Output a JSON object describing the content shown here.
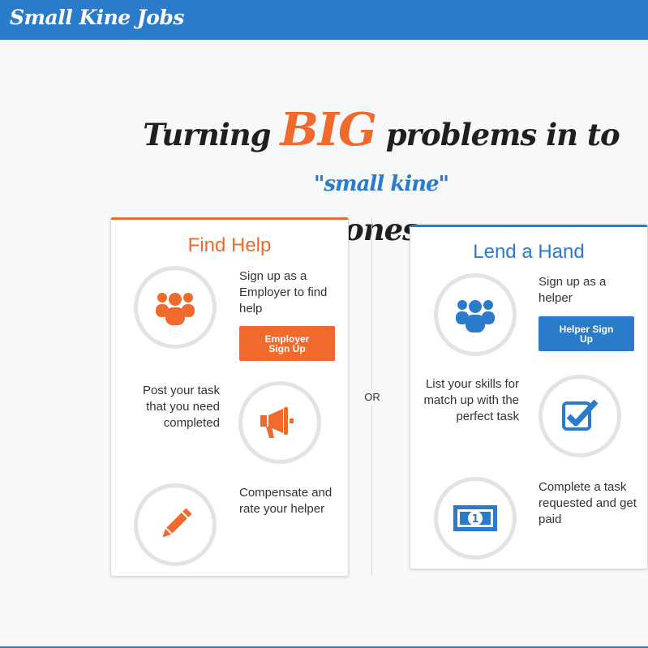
{
  "brand": {
    "name": "Small Kine Jobs"
  },
  "hero": {
    "part1": "Turning ",
    "big": "BIG",
    "part2": " problems in to ",
    "small_kine": "\"small kine\"",
    "part3": " ones"
  },
  "find_help": {
    "title": "Find Help",
    "step1_text": "Sign up as a Employer to find help",
    "signup_button": "Employer Sign Up",
    "step2_text": "Post your task that you need completed",
    "step3_text": "Compensate and rate your helper",
    "icons": [
      "group-icon",
      "megaphone-icon",
      "pencil-icon"
    ]
  },
  "or_label": "OR",
  "lend_hand": {
    "title": "Lend a Hand",
    "step1_text": "Sign up as a helper",
    "signup_button": "Helper Sign Up",
    "step2_text": "List your skills for match up with the perfect task",
    "step3_text": "Complete a task requested and get paid",
    "icons": [
      "group-icon",
      "checkbox-icon",
      "money-icon"
    ]
  },
  "colors": {
    "brand_blue": "#2a7ccb",
    "accent_orange": "#ef6a2b"
  }
}
